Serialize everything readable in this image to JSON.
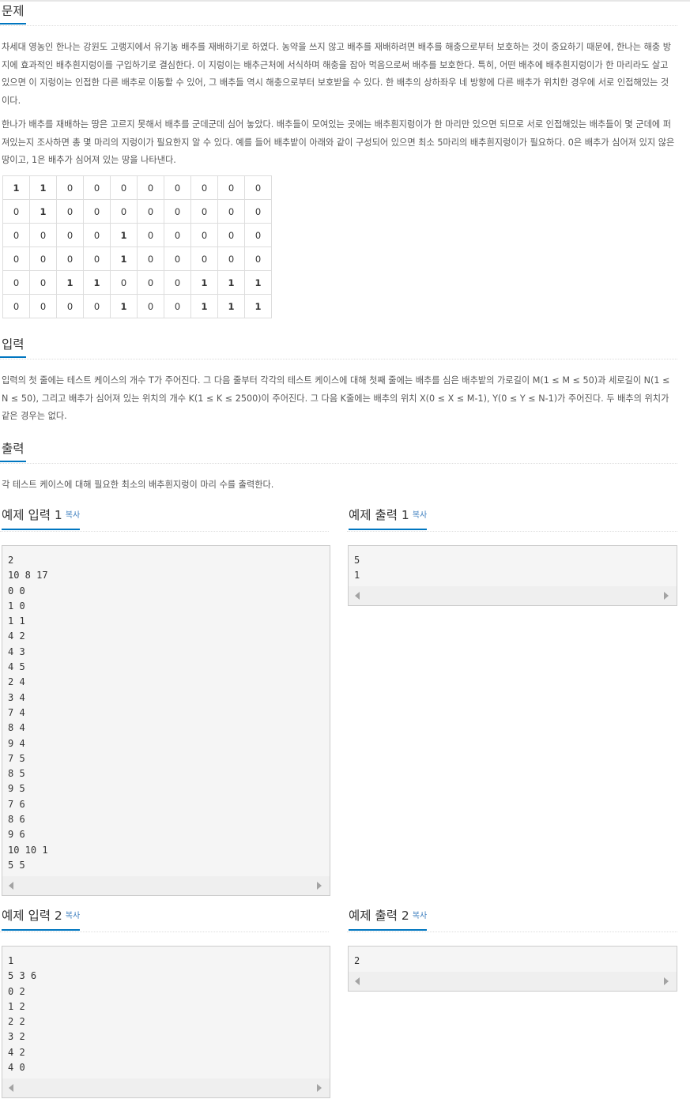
{
  "problem": {
    "title": "문제",
    "para1": "차세대 영농인 한나는 강원도 고랭지에서 유기농 배추를 재배하기로 하였다. 농약을 쓰지 않고 배추를 재배하려면 배추를 해충으로부터 보호하는 것이 중요하기 때문에, 한나는 해충 방지에 효과적인 배추흰지렁이를 구입하기로 결심한다. 이 지렁이는 배추근처에 서식하며 해충을 잡아 먹음으로써 배추를 보호한다. 특히, 어떤 배추에 배추흰지렁이가 한 마리라도 살고 있으면 이 지렁이는 인접한 다른 배추로 이동할 수 있어, 그 배추들 역시 해충으로부터 보호받을 수 있다. 한 배추의 상하좌우 네 방향에 다른 배추가 위치한 경우에 서로 인접해있는 것이다.",
    "para2": "한나가 배추를 재배하는 땅은 고르지 못해서 배추를 군데군데 심어 놓았다. 배추들이 모여있는 곳에는 배추흰지렁이가 한 마리만 있으면 되므로 서로 인접해있는 배추들이 몇 군데에 퍼져있는지 조사하면 총 몇 마리의 지렁이가 필요한지 알 수 있다. 예를 들어 배추밭이 아래와 같이 구성되어 있으면 최소 5마리의 배추흰지렁이가 필요하다. 0은 배추가 심어져 있지 않은 땅이고, 1은 배추가 심어져 있는 땅을 나타낸다.",
    "grid": [
      [
        "1",
        "1",
        "0",
        "0",
        "0",
        "0",
        "0",
        "0",
        "0",
        "0"
      ],
      [
        "0",
        "1",
        "0",
        "0",
        "0",
        "0",
        "0",
        "0",
        "0",
        "0"
      ],
      [
        "0",
        "0",
        "0",
        "0",
        "1",
        "0",
        "0",
        "0",
        "0",
        "0"
      ],
      [
        "0",
        "0",
        "0",
        "0",
        "1",
        "0",
        "0",
        "0",
        "0",
        "0"
      ],
      [
        "0",
        "0",
        "1",
        "1",
        "0",
        "0",
        "0",
        "1",
        "1",
        "1"
      ],
      [
        "0",
        "0",
        "0",
        "0",
        "1",
        "0",
        "0",
        "1",
        "1",
        "1"
      ]
    ]
  },
  "input": {
    "title": "입력",
    "text": "입력의 첫 줄에는 테스트 케이스의 개수 T가 주어진다. 그 다음 줄부터 각각의 테스트 케이스에 대해 첫째 줄에는 배추를 심은 배추밭의 가로길이 M(1 ≤ M ≤ 50)과 세로길이 N(1 ≤ N ≤ 50), 그리고 배추가 심어져 있는 위치의 개수 K(1 ≤ K ≤ 2500)이 주어진다. 그 다음 K줄에는 배추의 위치 X(0 ≤ X ≤ M-1), Y(0 ≤ Y ≤ N-1)가 주어진다. 두 배추의 위치가 같은 경우는 없다."
  },
  "output": {
    "title": "출력",
    "text": "각 테스트 케이스에 대해 필요한 최소의 배추흰지렁이 마리 수를 출력한다."
  },
  "copy_label": "복사",
  "examples": {
    "in1_title": "예제 입력 1",
    "out1_title": "예제 출력 1",
    "in2_title": "예제 입력 2",
    "out2_title": "예제 출력 2",
    "in1": "2\n10 8 17\n0 0\n1 0\n1 1\n4 2\n4 3\n4 5\n2 4\n3 4\n7 4\n8 4\n9 4\n7 5\n8 5\n9 5\n7 6\n8 6\n9 6\n10 10 1\n5 5",
    "out1": "5\n1",
    "in2": "1\n5 3 6\n0 2\n1 2\n2 2\n3 2\n4 2\n4 0",
    "out2": "2"
  }
}
